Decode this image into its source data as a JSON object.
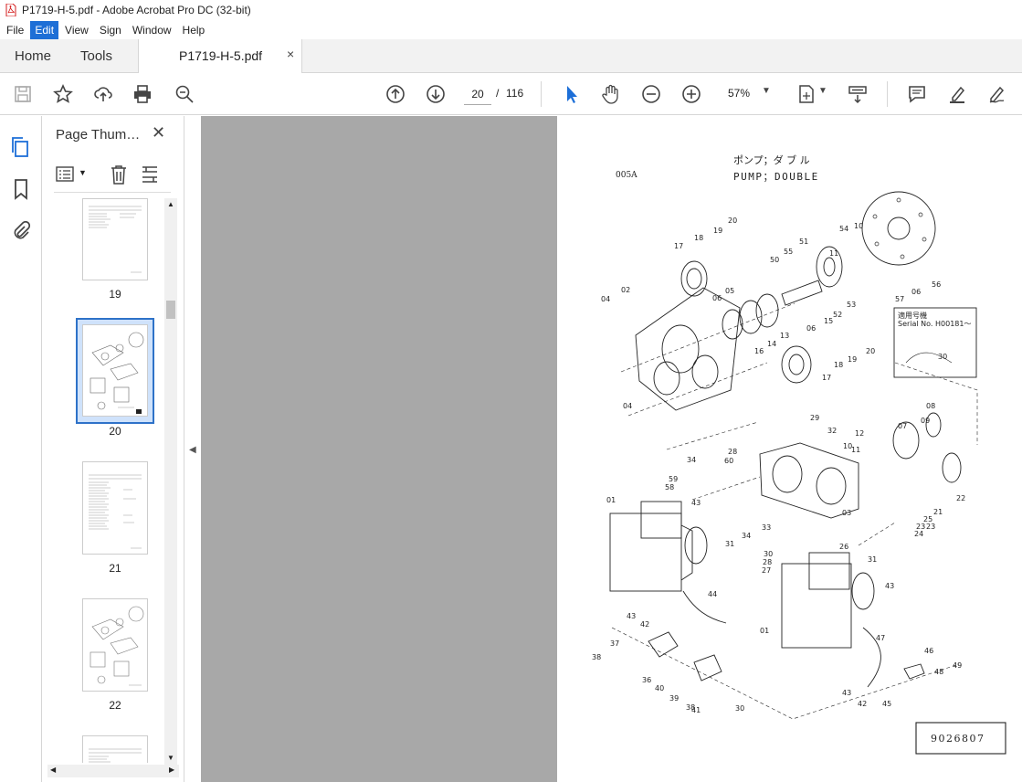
{
  "window": {
    "title": "P1719-H-5.pdf - Adobe Acrobat Pro DC (32-bit)"
  },
  "menu": {
    "items": [
      "File",
      "Edit",
      "View",
      "Sign",
      "Window",
      "Help"
    ],
    "active": "Edit"
  },
  "tabs": {
    "home": "Home",
    "tools": "Tools",
    "document": "P1719-H-5.pdf",
    "close": "×"
  },
  "toolbar": {
    "current_page": "20",
    "separator": "/",
    "total_pages": "116",
    "zoom": "57%",
    "icons": [
      "save-icon",
      "bookmark-star-icon",
      "upload-icon",
      "print-icon",
      "search-zoom-icon",
      "page-up-icon",
      "page-down-icon",
      "select-cursor-icon",
      "hand-icon",
      "zoom-out-icon",
      "zoom-in-icon",
      "fit-page-icon",
      "scroll-mode-icon",
      "comment-icon",
      "highlight-icon",
      "sign-icon"
    ]
  },
  "left_rail": {
    "icons": [
      "page-thumbnails-icon",
      "bookmarks-icon",
      "attachments-icon"
    ]
  },
  "thumbnail_panel": {
    "title": "Page Thumb...",
    "close": "✕",
    "pages": [
      "19",
      "20",
      "21",
      "22"
    ],
    "selected_page": "20"
  },
  "document": {
    "header_jp": "ポンプ；ダ ブ ル",
    "header_en": "PUMP；DOUBLE",
    "code": "005A",
    "serial_note_line1": "適用号機",
    "serial_note_line2": "Serial No. H00181～",
    "drawing_number": "9026807",
    "callouts": [
      "20",
      "19",
      "18",
      "17",
      "04",
      "02",
      "06",
      "05",
      "16",
      "14",
      "13",
      "50",
      "55",
      "51",
      "11",
      "54",
      "10",
      "56",
      "57",
      "06",
      "53",
      "52",
      "15",
      "06",
      "20",
      "19",
      "18",
      "17",
      "30",
      "04",
      "08",
      "07",
      "09",
      "12",
      "11",
      "10",
      "29",
      "32",
      "28",
      "60",
      "34",
      "59",
      "58",
      "03",
      "22",
      "23",
      "25",
      "21",
      "23",
      "24",
      "01",
      "43",
      "33",
      "34",
      "30",
      "28",
      "27",
      "26",
      "31",
      "31",
      "43",
      "44",
      "43",
      "42",
      "01",
      "47",
      "46",
      "48",
      "49",
      "38",
      "37",
      "36",
      "40",
      "39",
      "38",
      "41",
      "30",
      "43",
      "42",
      "45"
    ]
  }
}
